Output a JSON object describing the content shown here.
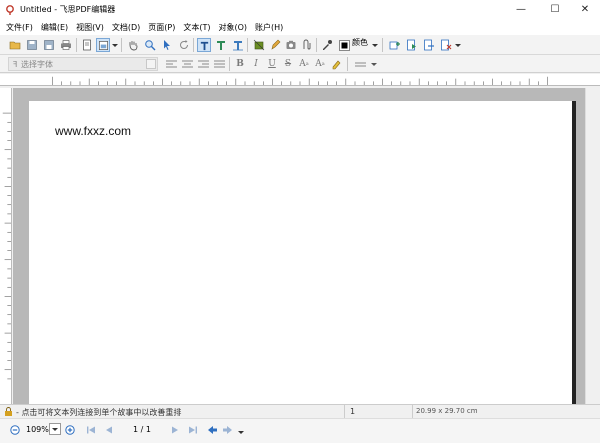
{
  "window": {
    "title": "Untitled - 飞思PDF编辑器",
    "min_glyph": "—",
    "max_glyph": "☐",
    "close_glyph": "✕"
  },
  "menu": [
    {
      "label": "文件(F)"
    },
    {
      "label": "编辑(E)"
    },
    {
      "label": "视图(V)"
    },
    {
      "label": "文档(D)"
    },
    {
      "label": "页面(P)"
    },
    {
      "label": "文本(T)"
    },
    {
      "label": "对象(O)"
    },
    {
      "label": "账户(H)"
    }
  ],
  "toolbar": {
    "color_label": "颜色",
    "font_placeholder": "选择字体",
    "format_buttons": {
      "bold": "B",
      "italic": "I",
      "underline": "U",
      "strike": "S",
      "superscript": "A",
      "subscript": "A"
    }
  },
  "document": {
    "text": "www.fxxz.com"
  },
  "status": {
    "hint": "点击可将文本列连接到单个故事中以改善重排",
    "page_num": "1",
    "page_size": "20.99 x 29.70 cm"
  },
  "navigation": {
    "zoom": "109%",
    "page_counter": "1 / 1"
  },
  "colors": {
    "accent_blue": "#2f6fc0",
    "page_bg": "#ffffff",
    "canvas_bg": "#b8b8b8"
  }
}
